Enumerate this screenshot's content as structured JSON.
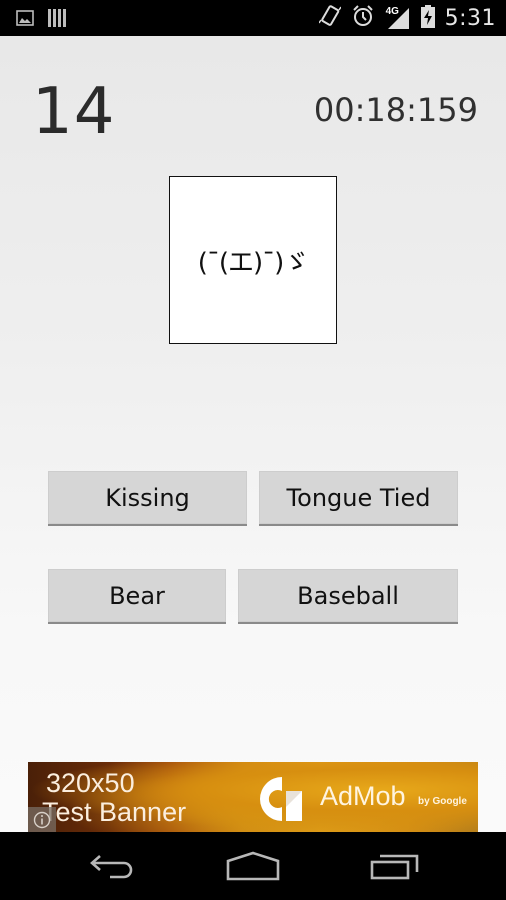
{
  "status_bar": {
    "left_icons": [
      "gallery-icon",
      "barcode-icon"
    ],
    "right_icons": [
      "vibrate-icon",
      "alarm-icon",
      "signal-4g-icon",
      "battery-charging-icon"
    ],
    "network_label": "4G",
    "time": "5:31"
  },
  "game": {
    "score": "14",
    "timer": "00:18:159",
    "emoticon": "(¯(エ)¯)ゞ",
    "answers": [
      {
        "label": "Kissing"
      },
      {
        "label": "Tongue Tied"
      },
      {
        "label": "Bear"
      },
      {
        "label": "Baseball"
      }
    ]
  },
  "ad": {
    "size_text": "320x50",
    "label_text": "Test Banner",
    "brand": "AdMob",
    "brand_sub": "by Google",
    "info_icon": "info-icon"
  },
  "nav_bar": {
    "buttons": [
      "back-icon",
      "home-icon",
      "recent-apps-icon"
    ]
  },
  "colors": {
    "button_bg": "#d6d6d6",
    "text_primary": "#2b2b2b",
    "ad_orange": "#e39e1a"
  }
}
